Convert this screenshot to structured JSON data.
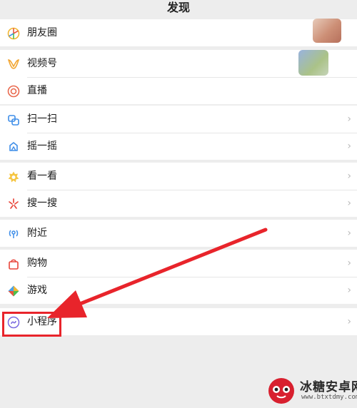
{
  "header": {
    "title": "发现"
  },
  "groups": [
    {
      "items": [
        {
          "label": "朋友圈",
          "icon": "moments-icon"
        }
      ]
    },
    {
      "items": [
        {
          "label": "视频号",
          "icon": "channels-icon"
        },
        {
          "label": "直播",
          "icon": "live-icon"
        }
      ]
    },
    {
      "items": [
        {
          "label": "扫一扫",
          "icon": "scan-icon",
          "chevron": "›"
        },
        {
          "label": "摇一摇",
          "icon": "shake-icon",
          "chevron": "›"
        }
      ]
    },
    {
      "items": [
        {
          "label": "看一看",
          "icon": "top-stories-icon",
          "chevron": "›"
        },
        {
          "label": "搜一搜",
          "icon": "search-icon",
          "chevron": "›"
        }
      ]
    },
    {
      "items": [
        {
          "label": "附近",
          "icon": "nearby-icon",
          "chevron": "›"
        }
      ]
    },
    {
      "items": [
        {
          "label": "购物",
          "icon": "shopping-bag-icon",
          "chevron": "›"
        },
        {
          "label": "游戏",
          "icon": "game-icon",
          "chevron": "›"
        }
      ]
    },
    {
      "items": [
        {
          "label": "小程序",
          "icon": "mini-program-icon",
          "chevron": "›"
        }
      ]
    }
  ],
  "annotation": {
    "color": "#e8242b"
  },
  "watermark": {
    "title": "冰糖安卓网",
    "url": "www.btxtdmy.com"
  }
}
